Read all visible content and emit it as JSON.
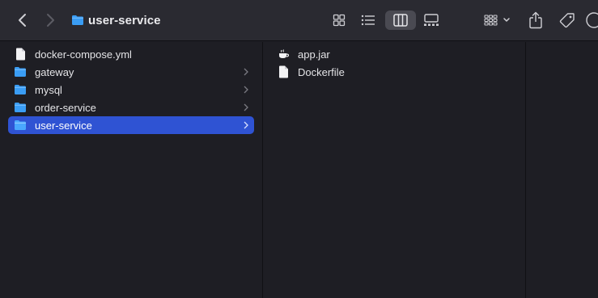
{
  "window": {
    "title": "user-service"
  },
  "toolbar": {
    "back_icon": "chevron-left-icon",
    "forward_icon": "chevron-right-icon",
    "title_icon": "folder-icon",
    "views": [
      "icon-view",
      "list-view",
      "column-view",
      "gallery-view"
    ],
    "selected_view": "column-view",
    "actions": [
      "group-icon",
      "share-icon",
      "tag-icon",
      "more-icon"
    ]
  },
  "columns": [
    {
      "items": [
        {
          "label": "docker-compose.yml",
          "icon": "document-icon",
          "has_children": false,
          "selected": false
        },
        {
          "label": "gateway",
          "icon": "folder-icon",
          "has_children": true,
          "selected": false
        },
        {
          "label": "mysql",
          "icon": "folder-icon",
          "has_children": true,
          "selected": false
        },
        {
          "label": "order-service",
          "icon": "folder-icon",
          "has_children": true,
          "selected": false
        },
        {
          "label": "user-service",
          "icon": "folder-icon",
          "has_children": true,
          "selected": true
        }
      ]
    },
    {
      "items": [
        {
          "label": "app.jar",
          "icon": "java-jar-icon",
          "has_children": false,
          "selected": false
        },
        {
          "label": "Dockerfile",
          "icon": "document-icon",
          "has_children": false,
          "selected": false
        }
      ]
    },
    {
      "items": []
    }
  ],
  "colors": {
    "background": "#1e1e24",
    "toolbar": "#2a2a31",
    "selection": "#2f53d3",
    "folder": "#3a9df5"
  }
}
